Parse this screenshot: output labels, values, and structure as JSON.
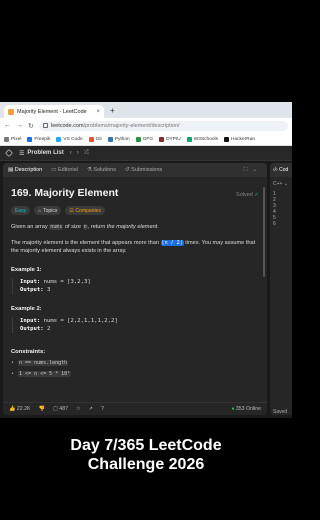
{
  "browser": {
    "tab_title": "Majority Element - LeetCode",
    "url_host": "leetcode.com",
    "url_path": "/problems/majority-element/description/",
    "bookmarks": [
      {
        "label": "Pixel",
        "color": "#7a7a7a"
      },
      {
        "label": "Freepik",
        "color": "#1273eb"
      },
      {
        "label": "VS Code",
        "color": "#23a9f2"
      },
      {
        "label": "Git",
        "color": "#f05032"
      },
      {
        "label": "Python",
        "color": "#3776ab"
      },
      {
        "label": "GFG",
        "color": "#2f8d46"
      },
      {
        "label": "DYPIU",
        "color": "#8b2b2b"
      },
      {
        "label": "W3Schools",
        "color": "#04aa6d"
      },
      {
        "label": "HackerRan",
        "color": "#111111"
      }
    ]
  },
  "lc_nav": {
    "problem_list": "Problem List"
  },
  "subtabs": {
    "description": "Description",
    "editorial": "Editorial",
    "solutions": "Solutions",
    "submissions": "Submissions"
  },
  "problem": {
    "title": "169. Majority Element",
    "status": "Solved",
    "difficulty": "Easy",
    "topics": "Topics",
    "companies": "Companies",
    "intro_a": "Given an array ",
    "intro_code1": "nums",
    "intro_b": " of size ",
    "intro_code2": "n",
    "intro_c": ", return ",
    "intro_em": "the majority element",
    "intro_d": ".",
    "desc_a": "The majority element is the element that appears more than ",
    "desc_code": "⌊n / 2⌋",
    "desc_b": " times. You may assume that the majority element always exists in the array.",
    "example1_title": "Example 1:",
    "example1_input_label": "Input:",
    "example1_input": "nums = [3,2,3]",
    "example1_output_label": "Output:",
    "example1_output": "3",
    "example2_title": "Example 2:",
    "example2_input_label": "Input:",
    "example2_input": "nums = [2,2,1,1,1,2,2]",
    "example2_output_label": "Output:",
    "example2_output": "2",
    "constraints_title": "Constraints:",
    "constraint1": "n == nums.length",
    "constraint2": "1 <= n <= 5 * 10⁴"
  },
  "footer": {
    "likes": "22.2K",
    "comments": "487",
    "online": "353 Online"
  },
  "editor": {
    "label": "Cod",
    "lang": "C++",
    "saved": "Saved",
    "test": "Testi"
  },
  "caption": {
    "line1": "Day 7/365 LeetCode",
    "line2": "Challenge 2026"
  }
}
